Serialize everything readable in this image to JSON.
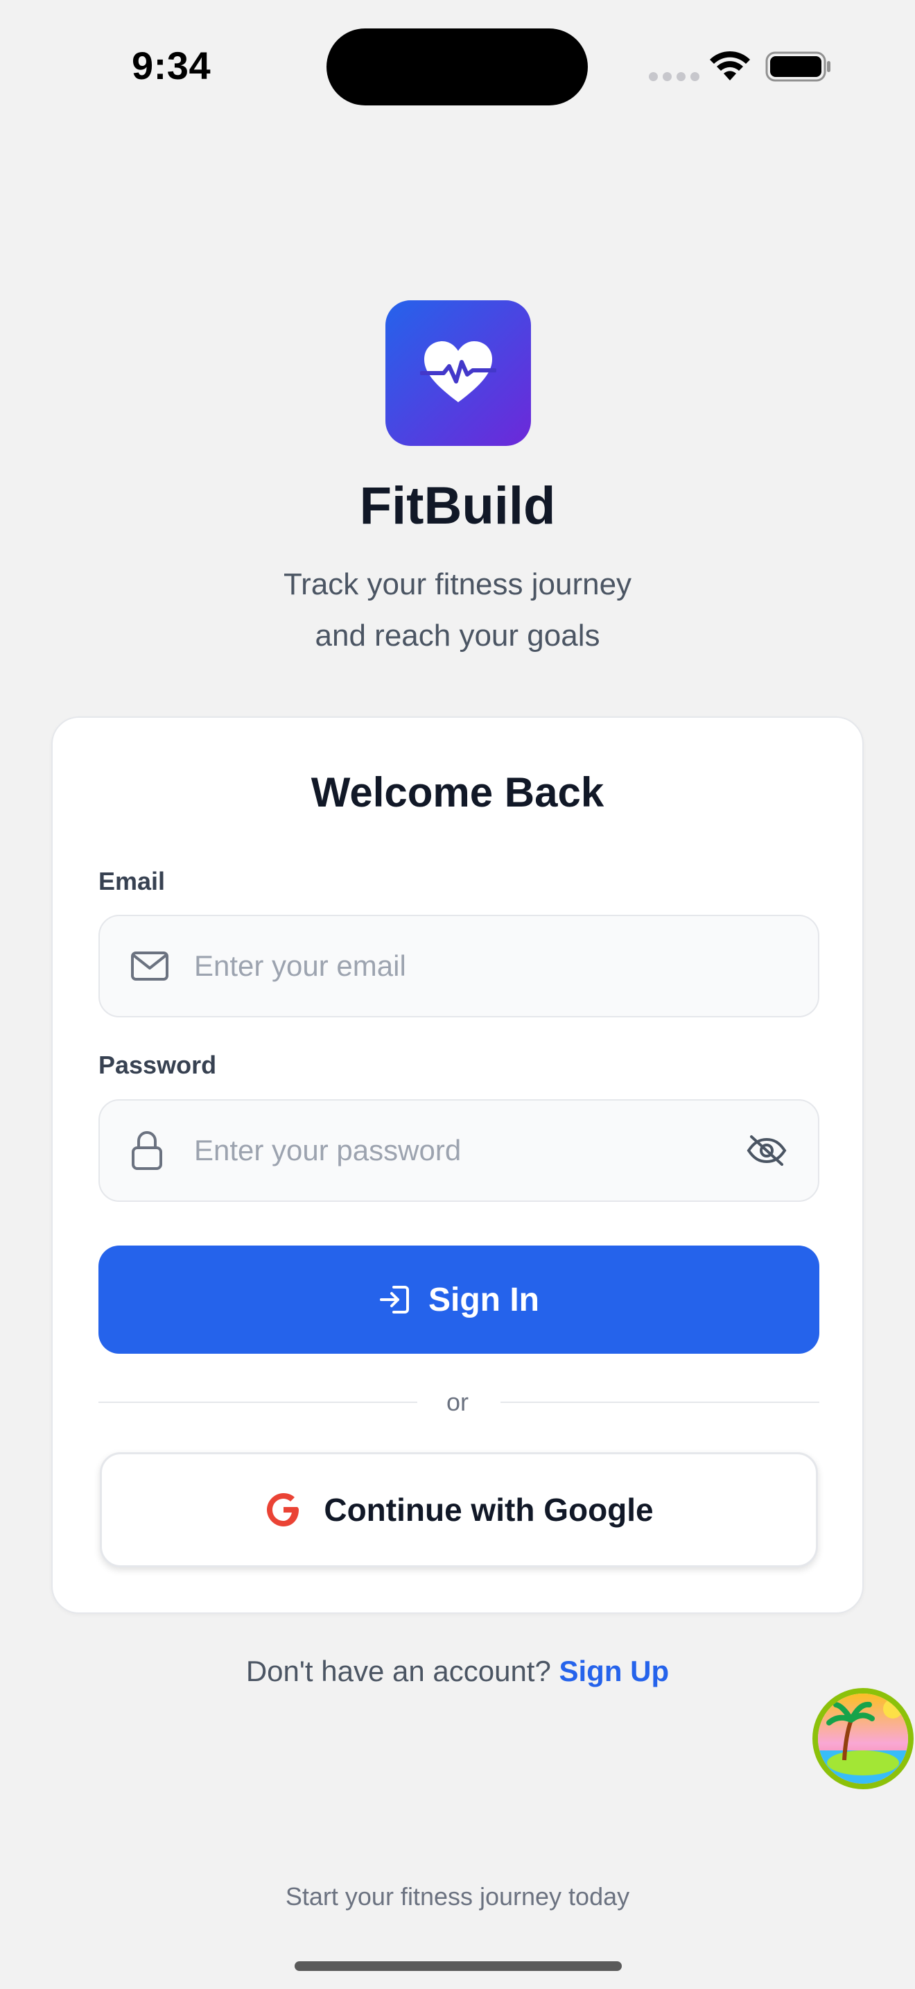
{
  "status_bar": {
    "time": "9:34"
  },
  "app": {
    "name": "FitBuild",
    "tagline_line1": "Track your fitness journey",
    "tagline_line2": "and reach your goals",
    "logo_icon": "heart-pulse-icon",
    "colors": {
      "primary": "#2563eb",
      "gradient_end": "#6d28d9"
    }
  },
  "card": {
    "title": "Welcome Back",
    "email": {
      "label": "Email",
      "placeholder": "Enter your email",
      "value": ""
    },
    "password": {
      "label": "Password",
      "placeholder": "Enter your password",
      "value": ""
    },
    "signin_label": "Sign In",
    "divider_text": "or",
    "google_label": "Continue with Google"
  },
  "signup": {
    "prompt": "Don't have an account?",
    "link": "Sign Up"
  },
  "footer": {
    "text": "Start your fitness journey today"
  }
}
